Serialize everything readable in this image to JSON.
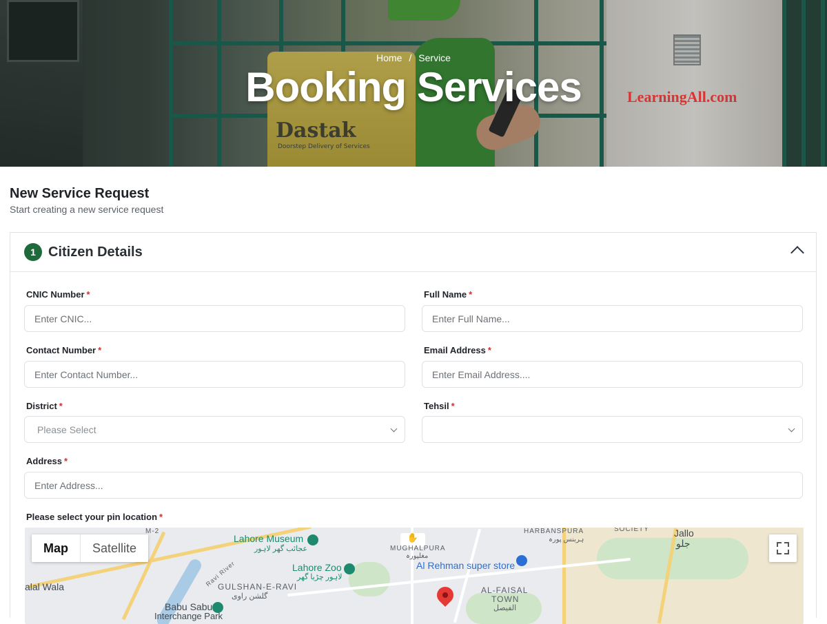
{
  "hero": {
    "breadcrumb": {
      "home": "Home",
      "separator": "/",
      "current": "Service"
    },
    "title": "Booking Services",
    "watermark": "LearningAll.com",
    "bag_logo": "Dastak",
    "bag_subtitle": "Doorstep Delivery of Services"
  },
  "page": {
    "title": "New Service Request",
    "subtitle": "Start creating a new service request"
  },
  "section": {
    "step_number": "1",
    "title": "Citizen Details"
  },
  "form": {
    "cnic": {
      "label": "CNIC Number",
      "required": "*",
      "placeholder": "Enter CNIC..."
    },
    "full_name": {
      "label": "Full Name",
      "required": "*",
      "placeholder": "Enter Full Name..."
    },
    "contact": {
      "label": "Contact Number",
      "required": "*",
      "placeholder": "Enter Contact Number..."
    },
    "email": {
      "label": "Email Address",
      "required": "*",
      "placeholder": "Enter Email Address...."
    },
    "district": {
      "label": "District",
      "required": "*",
      "selected": "Please Select"
    },
    "tehsil": {
      "label": "Tehsil",
      "required": "*",
      "selected": ""
    },
    "address": {
      "label": "Address",
      "required": "*",
      "placeholder": "Enter Address..."
    },
    "pin_location": {
      "label": "Please select your pin location",
      "required": "*"
    }
  },
  "map": {
    "map_label": "Map",
    "satellite_label": "Satellite",
    "places": {
      "lahore_museum": "Lahore Museum",
      "lahore_museum_ur": "عجائب گھر لاہور",
      "lahore_zoo": "Lahore Zoo",
      "lahore_zoo_ur": "لاہور چڑیا گھر",
      "gulshan_e_ravi": "GULSHAN-E-RAVI",
      "gulshan_e_ravi_ur": "گلشن راوی",
      "al_rehman": "Al Rehman super store",
      "al_faisal": "AL-FAISAL",
      "town": "TOWN",
      "al_faisal_ur": "الفیصل",
      "harbanspura": "HARBANSPURA",
      "harbanspura_ur": "ہربنس پورہ",
      "jallo": "Jallo",
      "jallo_ur": "جلو",
      "society": "SOCIETY",
      "mughalpura": "MUGHALPURA",
      "mughalpura_ur": "مغلپورہ",
      "alal_wala": "alal Wala",
      "babu_sabu": "Babu Sabu",
      "ravi_river": "Ravi River",
      "m2": "M-2",
      "interchange": "Interchange Park"
    },
    "colors": {
      "pin": "#e53935",
      "park": "#cfe5c7",
      "road": "#f3d27a",
      "water": "#a9cbe6"
    }
  },
  "colors": {
    "accent": "#1f6a3a",
    "required": "#d32f2f",
    "watermark": "#d93434"
  }
}
